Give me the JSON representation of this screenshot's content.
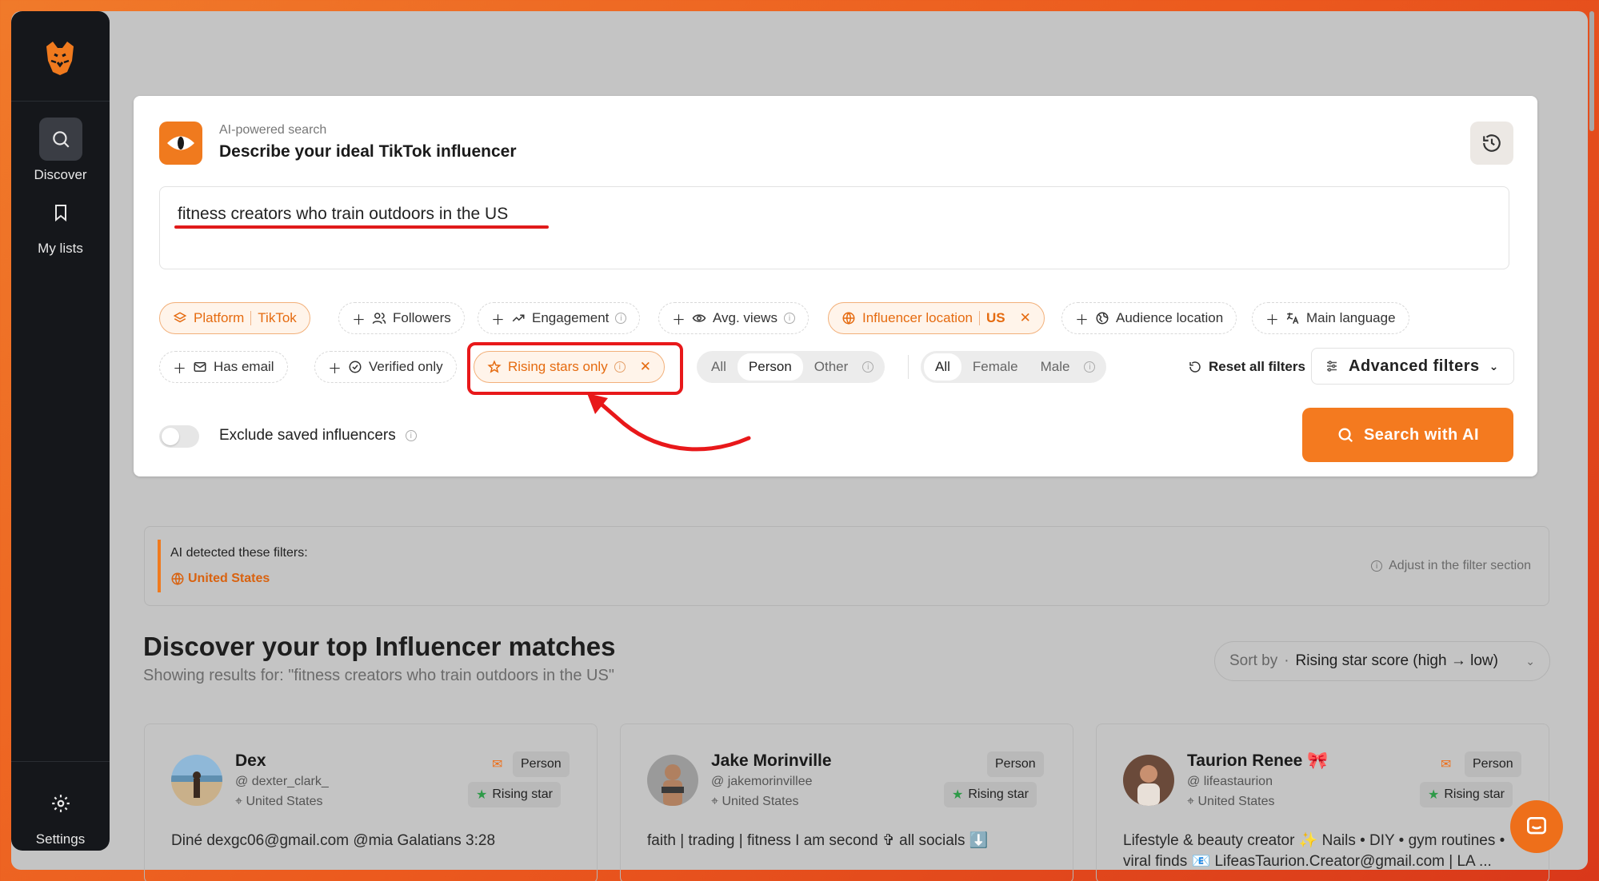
{
  "sidebar": {
    "items": [
      {
        "label": "Discover",
        "icon": "search-icon"
      },
      {
        "label": "My lists",
        "icon": "bookmark-icon"
      }
    ],
    "settings_label": "Settings"
  },
  "search_card": {
    "ai_label": "AI-powered search",
    "title": "Describe your ideal TikTok influencer",
    "query": "fitness creators who train outdoors in the US",
    "chips": {
      "platform_label": "Platform",
      "platform_value": "TikTok",
      "followers": "Followers",
      "engagement": "Engagement",
      "avg_views": "Avg. views",
      "location_label": "Influencer location",
      "location_value": "US",
      "audience_location": "Audience location",
      "main_language": "Main language",
      "has_email": "Has email",
      "verified_only": "Verified only",
      "rising_stars": "Rising stars only"
    },
    "type_segment": {
      "options": [
        "All",
        "Person",
        "Other"
      ],
      "selected": "Person"
    },
    "gender_segment": {
      "options": [
        "All",
        "Female",
        "Male"
      ],
      "selected": "All"
    },
    "reset_label": "Reset all filters",
    "advanced_label": "Advanced filters",
    "exclude_label": "Exclude saved influencers",
    "search_button": "Search with AI"
  },
  "detected": {
    "title": "AI detected these filters:",
    "tag": "United States",
    "adjust": "Adjust in the filter section"
  },
  "results": {
    "title": "Discover your top Influencer matches",
    "subtitle": "Showing results for: \"fitness creators who train outdoors in the US\"",
    "sort_label": "Sort by",
    "sort_value": "Rising star score (high → low)"
  },
  "profiles": [
    {
      "name": "Dex",
      "handle": "dexter_clark_",
      "location": "United States",
      "type": "Person",
      "badge": "Rising star",
      "bio": "Diné dexgc06@gmail.com @mia Galatians 3:28"
    },
    {
      "name": "Jake Morinville",
      "handle": "jakemorinvillee",
      "location": "United States",
      "type": "Person",
      "badge": "Rising star",
      "bio": "faith | trading | fitness I am second ✞ all socials ⬇️"
    },
    {
      "name": "Taurion Renee 🎀",
      "handle": "lifeastaurion",
      "location": "United States",
      "type": "Person",
      "badge": "Rising star",
      "bio": "Lifestyle & beauty creator ✨ Nails • DIY • gym routines • viral finds 📧 LifeasTaurion.Creator@gmail.com | LA ..."
    }
  ],
  "colors": {
    "accent": "#f47a1f",
    "annotation": "#e8181a"
  }
}
